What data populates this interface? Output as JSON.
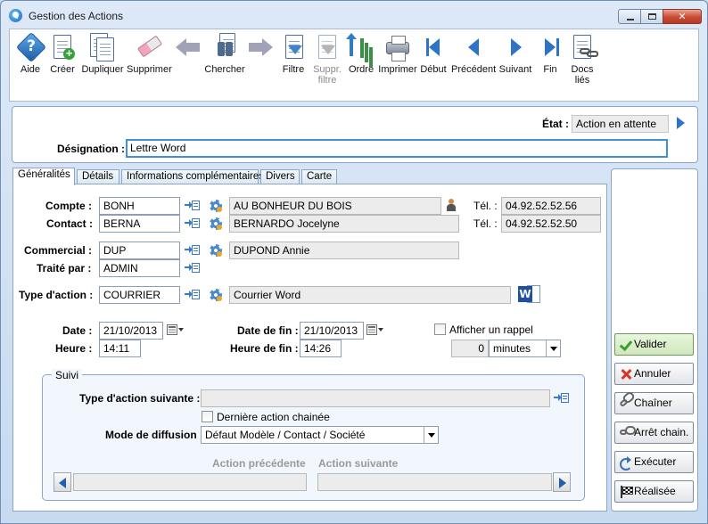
{
  "window": {
    "title": "Gestion des Actions"
  },
  "toolbar": {
    "aide": "Aide",
    "creer": "Créer",
    "dupliquer": "Dupliquer",
    "supprimer": "Supprimer",
    "chercher": "Chercher",
    "filtre": "Filtre",
    "suppr_filtre_1": "Suppr.",
    "suppr_filtre_2": "filtre",
    "ordre": "Ordre",
    "imprimer": "Imprimer",
    "debut": "Début",
    "precedent": "Précédent",
    "suivant": "Suivant",
    "fin": "Fin",
    "docs_1": "Docs",
    "docs_2": "liés"
  },
  "header": {
    "etat_label": "État :",
    "etat_value": "Action en attente",
    "designation_label": "Désignation :",
    "designation_value": "Lettre Word"
  },
  "tabs": [
    "Généralités",
    "Détails",
    "Informations complémentaires",
    "Divers",
    "Carte"
  ],
  "form": {
    "compte_label": "Compte :",
    "compte_code": "BONH",
    "compte_name": "AU BONHEUR DU BOIS",
    "tel_label": "Tél. :",
    "compte_tel": "04.92.52.52.56",
    "contact_label": "Contact :",
    "contact_code": "BERNA",
    "contact_name": "BERNARDO Jocelyne",
    "contact_tel": "04.92.52.52.50",
    "commercial_label": "Commercial :",
    "commercial_code": "DUP",
    "commercial_name": "DUPOND Annie",
    "traite_label": "Traité par :",
    "traite_code": "ADMIN",
    "type_label": "Type d'action :",
    "type_code": "COURRIER",
    "type_name": "Courrier Word",
    "date_label": "Date :",
    "date_value": "21/10/2013",
    "heure_label": "Heure :",
    "heure_value": "14:11",
    "datefin_label": "Date de fin :",
    "datefin_value": "21/10/2013",
    "heurefin_label": "Heure de fin :",
    "heurefin_value": "14:26",
    "rappel_label": "Afficher un rappel",
    "rappel_value": "0",
    "rappel_unit": "minutes"
  },
  "suivi": {
    "legend": "Suivi",
    "type_suivante_label": "Type d'action suivante :",
    "type_suivante_value": "",
    "derniere_label": "Dernière action chainée",
    "mode_label": "Mode de diffusion :",
    "mode_value": "Défaut Modèle / Contact / Société",
    "action_precedente": "Action précédente",
    "action_suivante": "Action suivante"
  },
  "side_buttons": {
    "valider": "Valider",
    "annuler": "Annuler",
    "chainer": "Chaîner",
    "arret": "Arrêt chain.",
    "executer": "Exécuter",
    "realisee": "Réalisée"
  }
}
